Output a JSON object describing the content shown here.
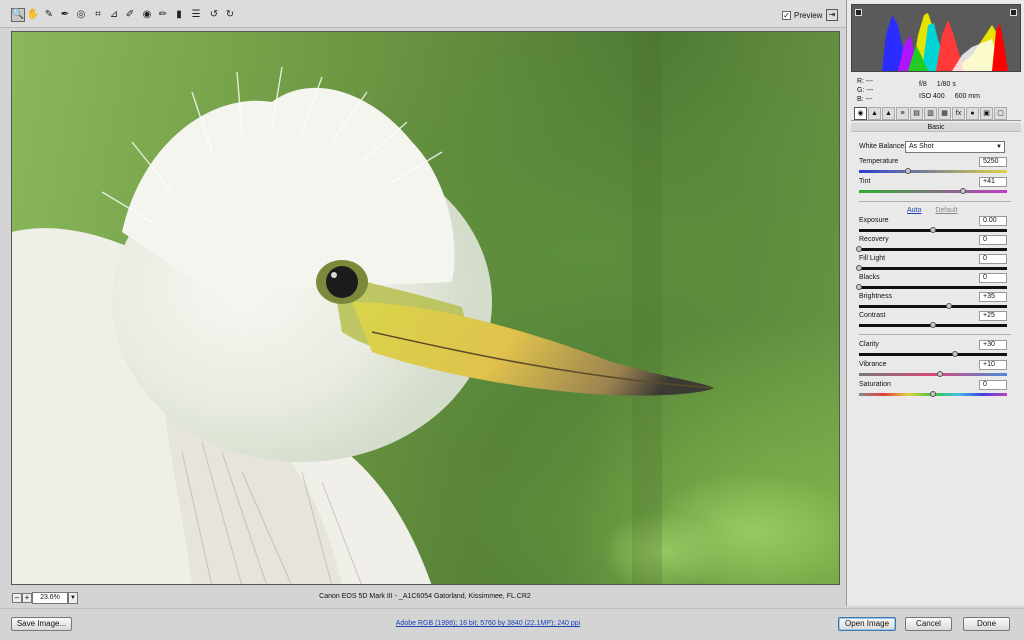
{
  "toolbar": {
    "tools": [
      {
        "name": "zoom-tool-icon",
        "glyph": "🔍",
        "active": true
      },
      {
        "name": "hand-tool-icon",
        "glyph": "✋"
      },
      {
        "name": "white-balance-tool-icon",
        "glyph": "✎"
      },
      {
        "name": "color-sampler-tool-icon",
        "glyph": "✒"
      },
      {
        "name": "targeted-adjustment-tool-icon",
        "glyph": "◎"
      },
      {
        "name": "crop-tool-icon",
        "glyph": "⌗"
      },
      {
        "name": "straighten-tool-icon",
        "glyph": "⊿"
      },
      {
        "name": "spot-removal-tool-icon",
        "glyph": "✐"
      },
      {
        "name": "red-eye-removal-tool-icon",
        "glyph": "◉"
      },
      {
        "name": "adjustment-brush-tool-icon",
        "glyph": "✏"
      },
      {
        "name": "graduated-filter-tool-icon",
        "glyph": "▮"
      },
      {
        "name": "preferences-icon",
        "glyph": "☰"
      },
      {
        "name": "rotate-ccw-icon",
        "glyph": "↺"
      },
      {
        "name": "rotate-cw-icon",
        "glyph": "↻"
      }
    ],
    "preview_label": "Preview",
    "preview_checked": "✓",
    "fullscreen_glyph": "⇥"
  },
  "image_status": {
    "zoom_out": "–",
    "zoom_in": "+",
    "zoom_level": "23.6%",
    "zoom_dropdown": "▼",
    "filename": "Canon EOS 5D Mark III  -  _A1C6054 Gatorland, Kissimmee, FL.CR2"
  },
  "panel": {
    "readout": {
      "r": "R:  ---",
      "g": "G:  ---",
      "b": "B:  ---",
      "aperture": "f/8",
      "shutter": "1/80 s",
      "iso": "ISO 400",
      "focal": "600 mm"
    },
    "tab_icons": [
      "◉",
      "▲",
      "▲",
      "≡",
      "▤",
      "▥",
      "▦",
      "fx",
      "●",
      "▣",
      "▢"
    ],
    "section_title": "Basic",
    "white_balance": {
      "label": "White Balance:",
      "value": "As Shot",
      "arrow": "▼"
    },
    "auto_label": "Auto",
    "default_label": "Default",
    "sliders": [
      {
        "label": "Temperature",
        "value": "5250",
        "pos": 0.33,
        "track": "temp"
      },
      {
        "label": "Tint",
        "value": "+41",
        "pos": 0.7,
        "track": "tint"
      },
      {
        "label": "Exposure",
        "value": "0.00",
        "pos": 0.5,
        "track": "gray"
      },
      {
        "label": "Recovery",
        "value": "0",
        "pos": 0.0,
        "track": "gray"
      },
      {
        "label": "Fill Light",
        "value": "0",
        "pos": 0.0,
        "track": "gray"
      },
      {
        "label": "Blacks",
        "value": "0",
        "pos": 0.0,
        "track": "gray"
      },
      {
        "label": "Brightness",
        "value": "+35",
        "pos": 0.61,
        "track": "gray"
      },
      {
        "label": "Contrast",
        "value": "+25",
        "pos": 0.5,
        "track": "gray"
      },
      {
        "label": "Clarity",
        "value": "+30",
        "pos": 0.65,
        "track": "gray"
      },
      {
        "label": "Vibrance",
        "value": "+10",
        "pos": 0.55,
        "track": "vib"
      },
      {
        "label": "Saturation",
        "value": "0",
        "pos": 0.5,
        "track": "sat"
      }
    ]
  },
  "footer": {
    "save_label": "Save Image...",
    "workflow": "Adobe RGB (1998); 16 bit; 5760 by 3840 (22.1MP); 240 ppi",
    "open_label": "Open Image",
    "cancel_label": "Cancel",
    "done_label": "Done"
  }
}
